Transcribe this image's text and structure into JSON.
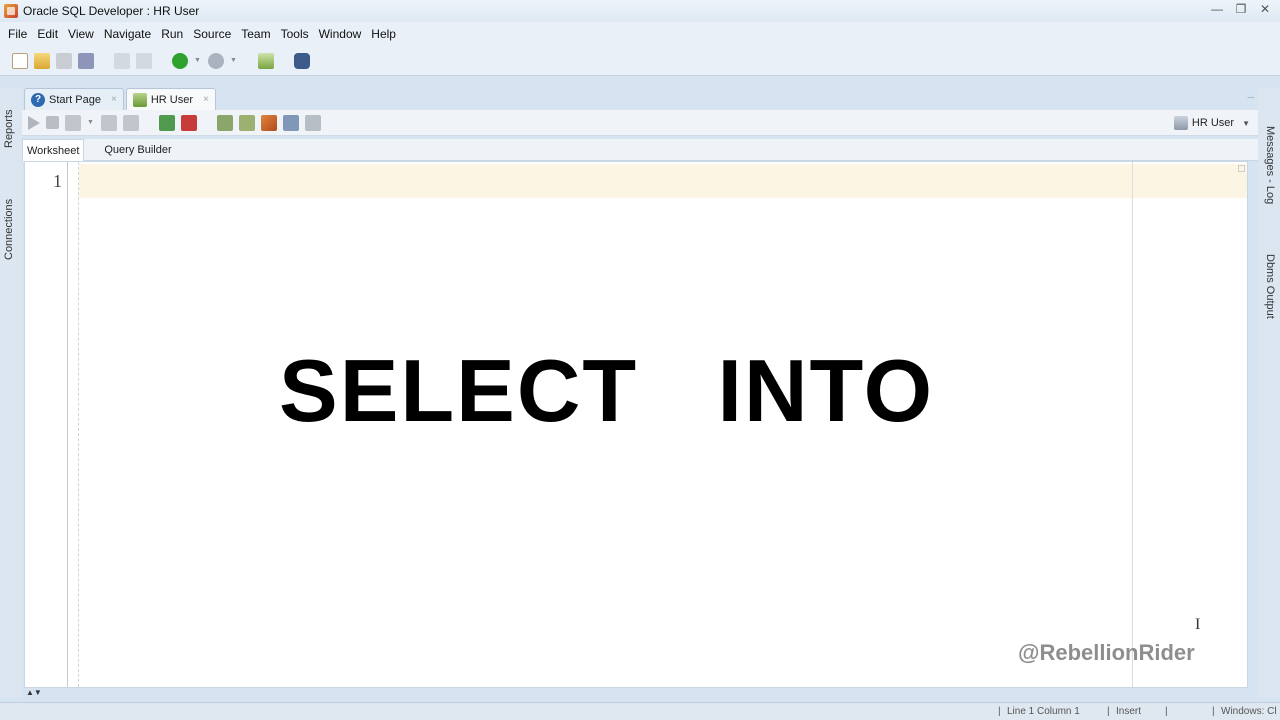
{
  "window": {
    "title": "Oracle SQL Developer : HR User"
  },
  "menu": [
    "File",
    "Edit",
    "View",
    "Navigate",
    "Run",
    "Source",
    "Team",
    "Tools",
    "Window",
    "Help"
  ],
  "side_panels": {
    "left": [
      "Reports",
      "Connections"
    ],
    "right": [
      "Messages - Log",
      "Dbms Output"
    ]
  },
  "tabs": [
    {
      "label": "Start Page",
      "close": "×"
    },
    {
      "label": "HR User",
      "close": "×"
    }
  ],
  "connection_selector": {
    "value": "HR User"
  },
  "subtabs": [
    "Worksheet",
    "Query Builder"
  ],
  "editor": {
    "line_number": "1",
    "overlay_title": "SELECT   INTO",
    "watermark": "@RebellionRider",
    "cursor_glyph": "I"
  },
  "statusbar": {
    "position": "Line 1 Column 1",
    "mode": "Insert",
    "platform": "Windows: Cl"
  },
  "colors": {
    "current_line": "#fdf5e3",
    "chrome": "#dbe6f1",
    "run_green": "#2fa12f"
  }
}
